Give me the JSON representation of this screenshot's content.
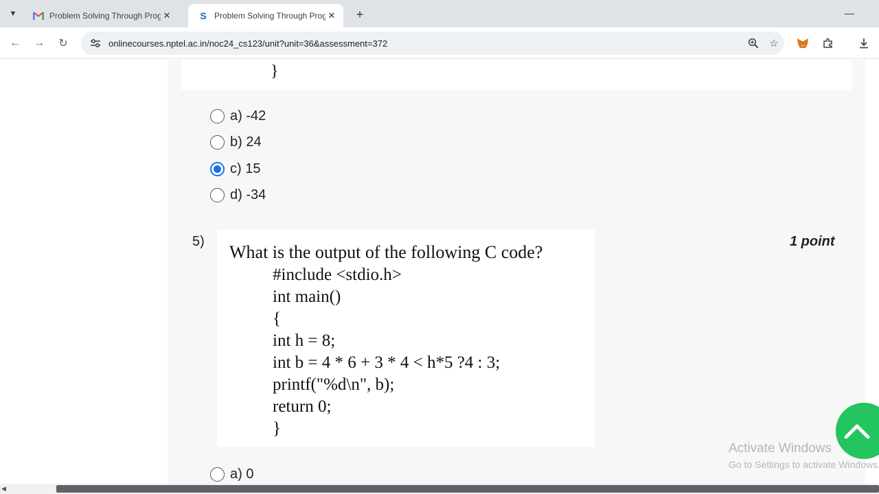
{
  "browser": {
    "tabs": [
      {
        "title": "Problem Solving Through Progr",
        "favicon": "gmail-icon",
        "active": false
      },
      {
        "title": "Problem Solving Through Progr",
        "favicon": "swayam-icon",
        "active": true
      }
    ],
    "new_tab_symbol": "+",
    "url": "onlinecourses.nptel.ac.in/noc24_cs123/unit?unit=36&assessment=372"
  },
  "prev_question": {
    "code_tail": "}",
    "options": [
      {
        "label": "a) -42",
        "selected": false
      },
      {
        "label": "b) 24",
        "selected": false
      },
      {
        "label": "c) 15",
        "selected": true
      },
      {
        "label": "d) -34",
        "selected": false
      }
    ]
  },
  "question5": {
    "number": "5)",
    "points": "1 point",
    "prompt": "What is the output of the following C code?",
    "code_lines": [
      "#include <stdio.h>",
      "int main()",
      "{",
      "int h = 8;",
      "int b = 4 * 6 + 3 * 4 < h*5 ?4 : 3;",
      "printf(\"%d\\n\", b);",
      "return 0;",
      "}"
    ],
    "options": [
      {
        "label": "a) 0",
        "selected": false
      }
    ]
  },
  "watermark": {
    "line1": "Activate Windows",
    "line2": "Go to Settings to activate Windows."
  },
  "colors": {
    "accent": "#1a73e8",
    "fab": "#22c55e"
  }
}
